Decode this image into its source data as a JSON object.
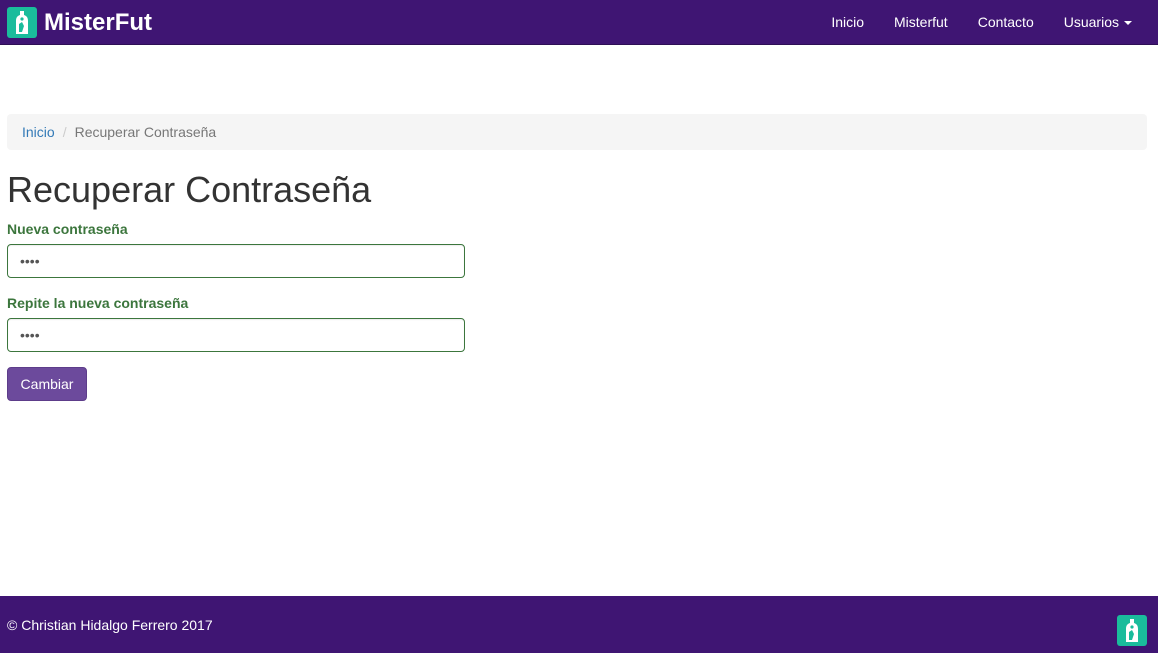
{
  "navbar": {
    "brand": "MisterFut",
    "items": [
      {
        "label": "Inicio"
      },
      {
        "label": "Misterfut"
      },
      {
        "label": "Contacto"
      },
      {
        "label": "Usuarios",
        "dropdown": true
      }
    ]
  },
  "breadcrumb": {
    "home": "Inicio",
    "separator": "/",
    "current": "Recuperar Contraseña"
  },
  "main": {
    "title": "Recuperar Contraseña",
    "new_password_label": "Nueva contraseña",
    "new_password_value": "••••",
    "repeat_password_label": "Repite la nueva contraseña",
    "repeat_password_value": "••••",
    "submit_label": "Cambiar"
  },
  "footer": {
    "copyright": "© Christian Hidalgo Ferrero 2017"
  },
  "colors": {
    "navbar_bg": "#3f1573",
    "logo_bg": "#1abc9c",
    "success_green": "#3c763d",
    "button_bg": "#6c4a9c",
    "link_blue": "#337ab7"
  },
  "icons": {
    "brand_logo": "bottle-logo-icon",
    "footer_logo": "bottle-logo-icon",
    "dropdown": "caret-down-icon"
  }
}
